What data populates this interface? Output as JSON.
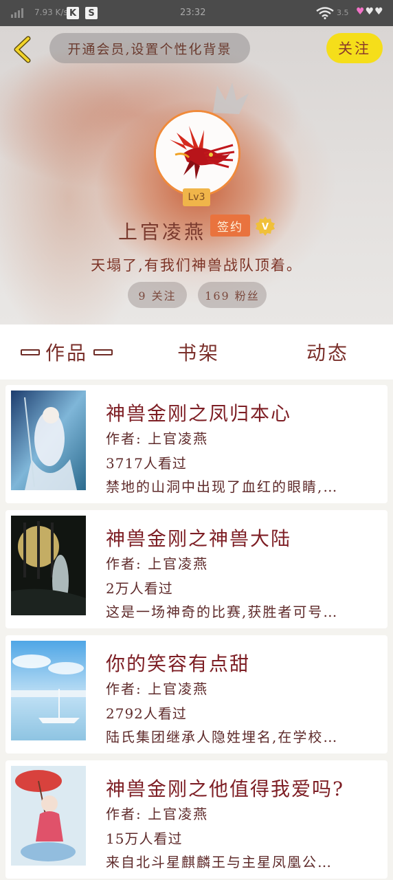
{
  "status_bar": {
    "net_speed": "7.93 K/s",
    "clock": "23:32",
    "net_speed_right": "3.5"
  },
  "header": {
    "vip_banner": "开通会员,设置个性化背景",
    "follow_label": "关注",
    "level": "Lv3",
    "username": "上官凌燕",
    "contract_badge": "签约",
    "verified_badge": "V",
    "signature": "天塌了,有我们神兽战队顶着。",
    "following": "9 关注",
    "fans": "169 粉丝"
  },
  "tabs": [
    {
      "label": "作品"
    },
    {
      "label": "书架"
    },
    {
      "label": "动态"
    }
  ],
  "books": [
    {
      "title": "神兽金刚之凤归本心",
      "author": "作者: 上官凌燕",
      "views": "3717人看过",
      "summary": "禁地的山洞中出现了血红的眼睛,…"
    },
    {
      "title": "神兽金刚之神兽大陆",
      "author": "作者: 上官凌燕",
      "views": "2万人看过",
      "summary": "这是一场神奇的比赛,获胜者可号…"
    },
    {
      "title": "你的笑容有点甜",
      "author": "作者: 上官凌燕",
      "views": "2792人看过",
      "summary": "陆氏集团继承人隐姓埋名,在学校…"
    },
    {
      "title": "神兽金刚之他值得我爱吗?",
      "author": "作者: 上官凌燕",
      "views": "15万人看过",
      "summary": "来自北斗星麒麟王与主星凤凰公…"
    }
  ],
  "colors": {
    "accent_yellow": "#f5de1a",
    "title_red": "#7d1e24",
    "badge_orange": "#e9733e",
    "avatar_ring": "#f08a3a"
  }
}
